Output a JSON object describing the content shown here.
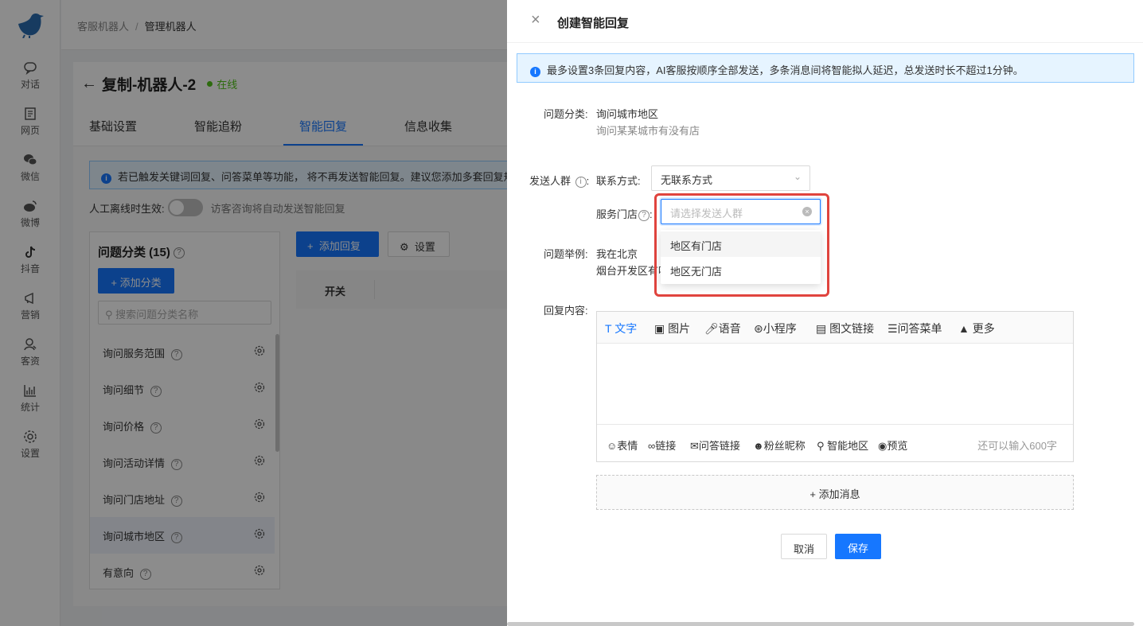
{
  "rail": {
    "items": [
      {
        "label": "对话",
        "icon": "chat-icon"
      },
      {
        "label": "网页",
        "icon": "webpage-icon"
      },
      {
        "label": "微信",
        "icon": "wechat-icon"
      },
      {
        "label": "微博",
        "icon": "weibo-icon"
      },
      {
        "label": "抖音",
        "icon": "douyin-icon"
      },
      {
        "label": "营销",
        "icon": "megaphone-icon"
      },
      {
        "label": "客资",
        "icon": "leads-icon"
      },
      {
        "label": "统计",
        "icon": "stats-icon"
      },
      {
        "label": "设置",
        "icon": "gear-icon"
      }
    ]
  },
  "breadcrumb": {
    "parent": "客服机器人",
    "sep": "/",
    "current": "管理机器人"
  },
  "bot": {
    "name": "复制-机器人-2",
    "status": "在线"
  },
  "tabs": [
    "基础设置",
    "智能追粉",
    "智能回复",
    "信息收集"
  ],
  "main": {
    "notice": "若已触发关键词回复、问答菜单等功能， 将不再发送智能回复。建议您添加多套回复规则",
    "toggle_label": "人工离线时生效:",
    "toggle_hint": "访客咨询将自动发送智能回复",
    "cat_title": "问题分类 (15)",
    "add_cat": "+ 添加分类",
    "search_placeholder": "搜索问题分类名称",
    "categories": [
      "询问服务范围",
      "询问细节",
      "询问价格",
      "询问活动详情",
      "询问门店地址",
      "询问城市地区",
      "有意向"
    ],
    "add_reply": "添加回复",
    "settings": "设置",
    "col_switch": "开关"
  },
  "drawer": {
    "title": "创建智能回复",
    "notice": "最多设置3条回复内容，AI客服按顺序全部发送，多条消息间将智能拟人延迟，总发送时长不超过1分钟。",
    "category_label": "问题分类:",
    "category_value": "询问城市地区",
    "category_sub": "询问某某城市有没有店",
    "audience_label": "发送人群",
    "contact_label": "联系方式:",
    "contact_value": "无联系方式",
    "store_label": "服务门店",
    "store_placeholder": "请选择发送人群",
    "store_options": [
      "地区有门店",
      "地区无门店"
    ],
    "example_label": "问题举例:",
    "example_1": "我在北京",
    "example_2": "烟台开发区有吗",
    "reply_label": "回复内容:",
    "tools": [
      "文字",
      "图片",
      "语音",
      "小程序",
      "图文链接",
      "问答菜单",
      "更多"
    ],
    "foot_tools": [
      "表情",
      "链接",
      "问答链接",
      "粉丝昵称",
      "智能地区",
      "预览"
    ],
    "char_count": "还可以输入600字",
    "add_msg": "+ 添加消息",
    "cancel": "取消",
    "save": "保存"
  },
  "colors": {
    "primary": "#1677ff",
    "online": "#52c41a",
    "highlight": "#e0443e"
  }
}
